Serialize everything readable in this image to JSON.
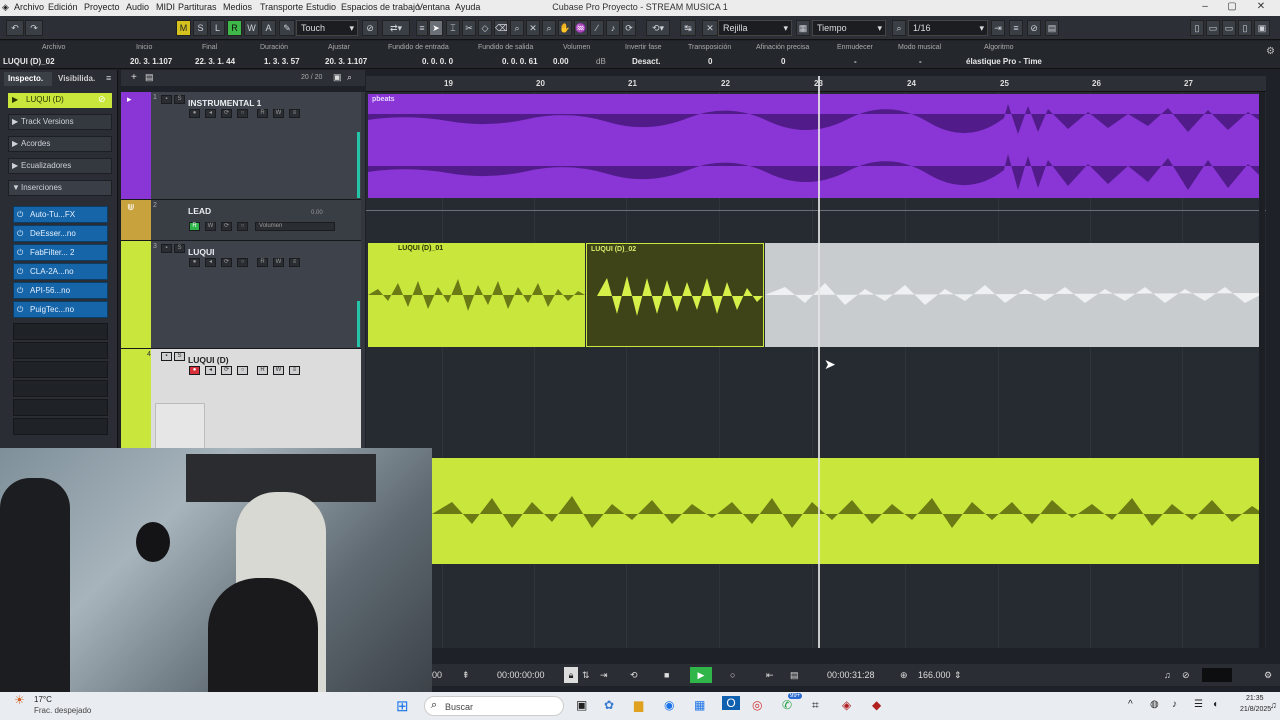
{
  "window": {
    "title": "Cubase Pro Proyecto - STREAM MUSICA 1"
  },
  "menu": [
    "Archivo",
    "Edición",
    "Proyecto",
    "Audio",
    "MIDI",
    "Partituras",
    "Medios",
    "Transporte",
    "Estudio",
    "Espacios de trabajo",
    "Ventana",
    "Ayuda"
  ],
  "toolbar": {
    "m": "M",
    "s": "S",
    "l": "L",
    "r": "R",
    "w": "W",
    "a": "A",
    "automation_mode": "Touch",
    "snap_type": "Rejilla",
    "grid_type": "Tiempo",
    "quantize": "1/16"
  },
  "infoline": {
    "headers": [
      "Archivo",
      "Inicio",
      "Final",
      "Duración",
      "Ajustar",
      "Fundido de entrada",
      "Fundido de salida",
      "Volumen",
      "Invertir fase",
      "Transposición",
      "Afinación precisa",
      "Enmudecer",
      "Modo musical",
      "Algoritmo"
    ],
    "values": {
      "archivo": "LUQUI (D)_02",
      "inicio": "20. 3. 1.107",
      "final": "22. 3. 1. 44",
      "duracion": "1. 3. 3. 57",
      "ajustar": "20. 3. 1.107",
      "fundido_entrada": "0. 0. 0. 0",
      "fundido_salida": "0. 0. 0. 61",
      "volumen": "0.00",
      "volumen_unit": "dB",
      "invertir": "Desact.",
      "transposicion": "0",
      "afinacion": "0",
      "enmudecer": "-",
      "modo": "-",
      "algoritmo": "élastique Pro - Time"
    }
  },
  "inspector": {
    "tabs": [
      "Inspecto.",
      "Visibilida."
    ],
    "track": "LUQUI (D)",
    "sections": [
      "Track Versions",
      "Acordes",
      "Ecualizadores",
      "Inserciones"
    ],
    "inserts": [
      "Auto-Tu...FX",
      "DeEsser...no",
      "FabFilter... 2",
      "CLA-2A...no",
      "API-56...no",
      "PuigTec...no"
    ]
  },
  "tracklist": {
    "counter": "20 / 20",
    "tracks": [
      {
        "name": "INSTRUMENTAL 1",
        "number": "1"
      },
      {
        "name": "LEAD",
        "number": "2",
        "fader_label": "Volumen",
        "fader_value": "0.00"
      },
      {
        "name": "LUQUI",
        "number": "3"
      },
      {
        "name": "LUQUI (D)",
        "number": "4"
      }
    ]
  },
  "ruler": {
    "bars": [
      "19",
      "20",
      "21",
      "22",
      "23",
      "24",
      "25",
      "26",
      "27"
    ]
  },
  "clips": {
    "instrumental": "pbeats",
    "luqui_d_01": "LUQUI (D)_01",
    "luqui_d_02": "LUQUI (D)_02"
  },
  "transport": {
    "left_time": "00:00:00:00",
    "left_time_short": "00",
    "main_time": "00:00:31:28",
    "tempo": "166.000"
  },
  "taskbar": {
    "weather_temp": "17°C",
    "weather_desc": "Frac. despejado",
    "search": "Buscar",
    "badge": "99+",
    "time": "21:35",
    "date": "21/8/2025"
  },
  "colors": {
    "purple": "#8a35d6",
    "lime": "#c8e63c",
    "accent_blue": "#1565a8"
  }
}
